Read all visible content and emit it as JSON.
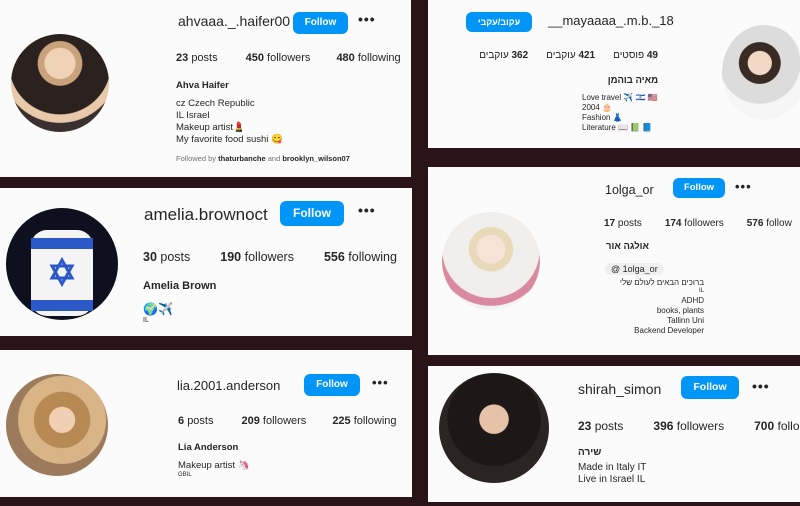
{
  "profiles": [
    {
      "username": "ahvaaa._.haifer00",
      "follow": "Follow",
      "posts": "23",
      "posts_label": "posts",
      "followers": "450",
      "followers_label": "followers",
      "following": "480",
      "following_label": "following",
      "name": "Ahva Haifer",
      "bio": [
        "cz Czech Republic",
        "IL Israel",
        "Makeup artist💄",
        "My favorite food sushi 😋"
      ],
      "followed_by_prefix": "Followed by",
      "followed_by_1": "thaturbanche",
      "followed_by_and": "and",
      "followed_by_2": "brooklyn_wilson07"
    },
    {
      "username": "__mayaaaa_.m.b._18",
      "follow": "עקוב/עקבי",
      "posts": "49",
      "posts_label": "פוסטים",
      "followers": "421",
      "followers_label": "עוקבים",
      "following": "362",
      "following_label": "עוקבים",
      "name": "מאיה בוהמן",
      "bio": [
        "Love travel ✈️ 🇮🇱 🇺🇸",
        "2004 🎂",
        "Fashion 👗",
        "Literature 📖 📗 📘"
      ]
    },
    {
      "username": "amelia.brownoct",
      "follow": "Follow",
      "posts": "30",
      "posts_label": "posts",
      "followers": "190",
      "followers_label": "followers",
      "following": "556",
      "following_label": "following",
      "name": "Amelia Brown",
      "bio": [
        "🌍✈️",
        "IL"
      ]
    },
    {
      "username": "1olga_or",
      "follow": "Follow",
      "posts": "17",
      "posts_label": "posts",
      "followers": "174",
      "followers_label": "followers",
      "following": "576",
      "following_label": "follow",
      "name": "אולגה אור",
      "threads": "1olga_or",
      "bio": [
        "ברוכים הבאים לעולם שלי",
        "IL",
        "ADHD",
        "books, plants",
        "Tallinn Uni",
        "Backend Developer"
      ]
    },
    {
      "username": "lia.2001.anderson",
      "follow": "Follow",
      "posts": "6",
      "posts_label": "posts",
      "followers": "209",
      "followers_label": "followers",
      "following": "225",
      "following_label": "following",
      "name": "Lia Anderson",
      "bio": [
        "Makeup artist 🦄",
        "GBIL"
      ]
    },
    {
      "username": "shirah_simon",
      "follow": "Follow",
      "posts": "23",
      "posts_label": "posts",
      "followers": "396",
      "followers_label": "followers",
      "following": "700",
      "following_label": "follo",
      "name": "שירה",
      "bio": [
        "Made in Italy IT",
        "Live in Israel IL"
      ]
    }
  ],
  "colors": {
    "button": "#0095f6",
    "background": "#2a1418",
    "card": "#fbfbfb"
  }
}
